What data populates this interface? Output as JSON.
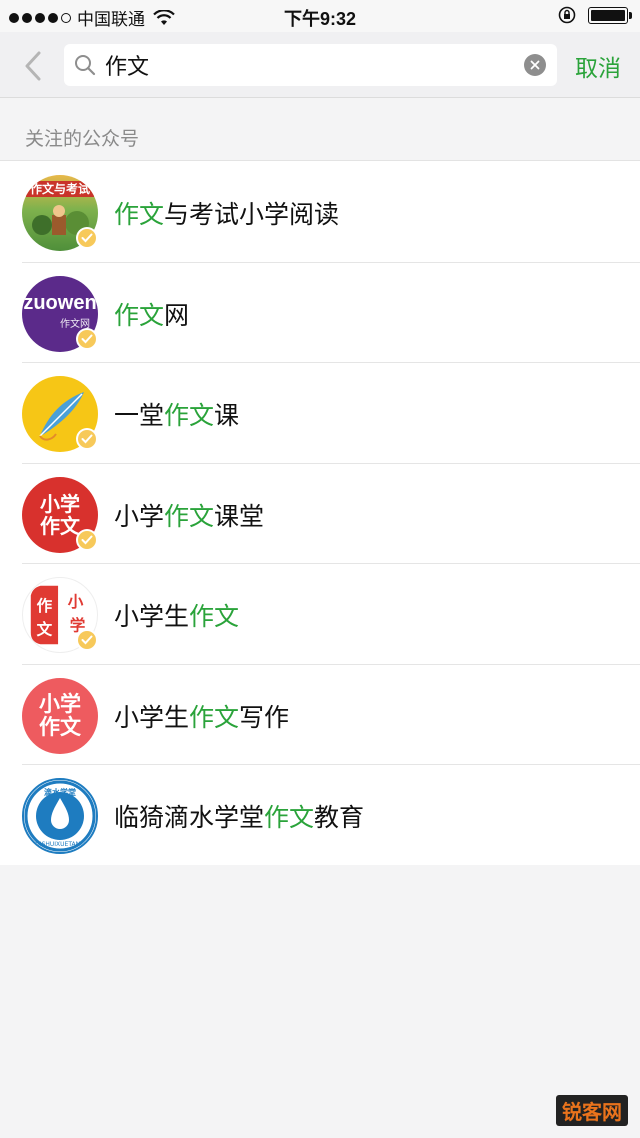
{
  "status_bar": {
    "carrier": "中国联通",
    "time": "下午9:32",
    "battery_level": 1.0
  },
  "search": {
    "query": "作文",
    "cancel_label": "取消"
  },
  "section": {
    "title": "关注的公众号"
  },
  "accounts": [
    {
      "pre": "",
      "hl": "作文",
      "post": "与考试小学阅读",
      "avatar_text": "作文与考试",
      "verified": true
    },
    {
      "pre": "",
      "hl": "作文",
      "post": "网",
      "avatar_text": "zuowen",
      "avatar_sub": "作文网",
      "verified": true
    },
    {
      "pre": "一堂",
      "hl": "作文",
      "post": "课",
      "verified": true
    },
    {
      "pre": "小学",
      "hl": "作文",
      "post": "课堂",
      "avatar_text": "小学作文",
      "verified": true
    },
    {
      "pre": "小学生",
      "hl": "作文",
      "post": "",
      "avatar_text": "作文小学",
      "verified": true
    },
    {
      "pre": "小学生",
      "hl": "作文",
      "post": "写作",
      "avatar_text": "小学作文",
      "verified": false
    },
    {
      "pre": "临猗滴水学堂",
      "hl": "作文",
      "post": "教育",
      "avatar_text": "滴水学堂",
      "avatar_sub": "DISHUIXUETANG",
      "verified": false
    }
  ],
  "colors": {
    "accent": "#2aa33a",
    "badge": "#f7c95a"
  },
  "watermark": {
    "logo": "锐客网"
  }
}
